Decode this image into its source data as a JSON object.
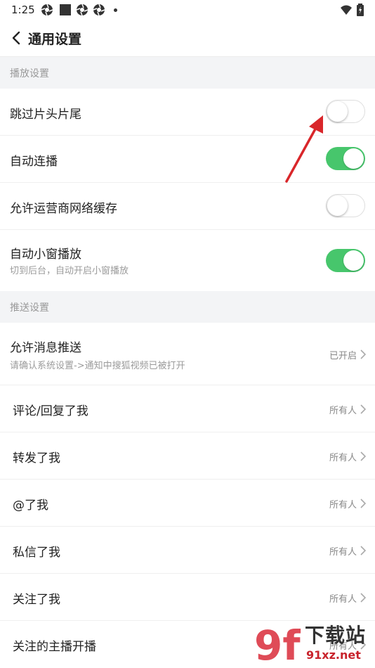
{
  "status": {
    "time": "1:25"
  },
  "header": {
    "title": "通用设置"
  },
  "sections": [
    {
      "title": "播放设置",
      "items": [
        {
          "label": "跳过片头片尾",
          "toggle": "off"
        },
        {
          "label": "自动连播",
          "toggle": "on"
        },
        {
          "label": "允许运营商网络缓存",
          "toggle": "off"
        },
        {
          "label": "自动小窗播放",
          "subtitle": "切到后台，自动开启小窗播放",
          "toggle": "on"
        }
      ]
    },
    {
      "title": "推送设置",
      "items": [
        {
          "label": "允许消息推送",
          "subtitle": "请确认系统设置->通知中搜狐视频已被打开",
          "value": "已开启"
        },
        {
          "label": "评论/回复了我",
          "value": "所有人"
        },
        {
          "label": "转发了我",
          "value": "所有人"
        },
        {
          "label": "@了我",
          "value": "所有人"
        },
        {
          "label": "私信了我",
          "value": "所有人"
        },
        {
          "label": "关注了我",
          "value": "所有人"
        },
        {
          "label": "关注的主播开播",
          "value": "所有人"
        }
      ]
    }
  ],
  "watermark": {
    "text": "下载站",
    "url": "91xz.net",
    "logo": "9f"
  },
  "colors": {
    "toggle_on": "#47c66c",
    "section_bg": "#f3f4f6",
    "arrow": "#d9262a"
  }
}
